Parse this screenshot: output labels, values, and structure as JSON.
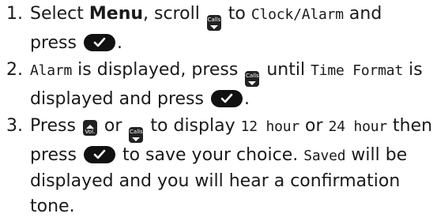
{
  "steps": [
    {
      "num": "1.",
      "t1": "Select ",
      "menu": "Menu",
      "t2": ", scroll ",
      "key_calls": "Calls",
      "t3": " to ",
      "d1": "Clock/Alarm",
      "t4": " and",
      "t5": "press ",
      "t6": "."
    },
    {
      "num": "2.",
      "d1": "Alarm",
      "t1": " is displayed, press ",
      "key_calls": "Calls",
      "t2": " until ",
      "d2": "Time Format",
      "t3": " is",
      "t4": "displayed and press ",
      "t5": "."
    },
    {
      "num": "3.",
      "t1": "Press ",
      "key_vol": "Vol.",
      "t2": " or ",
      "key_calls": "Calls",
      "t3": " to display ",
      "d1": "12 hour",
      "t4": " or ",
      "d2": "24 hour",
      "t5": " then",
      "t6": "press ",
      "t7": " to save your choice. ",
      "d3": "Saved",
      "t8": " will be",
      "t9": "displayed and you will hear a confirmation tone."
    }
  ],
  "icons": {
    "down_key": "calls-down-key-icon",
    "up_key": "volume-up-key-icon",
    "ok_key": "ok-check-key-icon"
  }
}
